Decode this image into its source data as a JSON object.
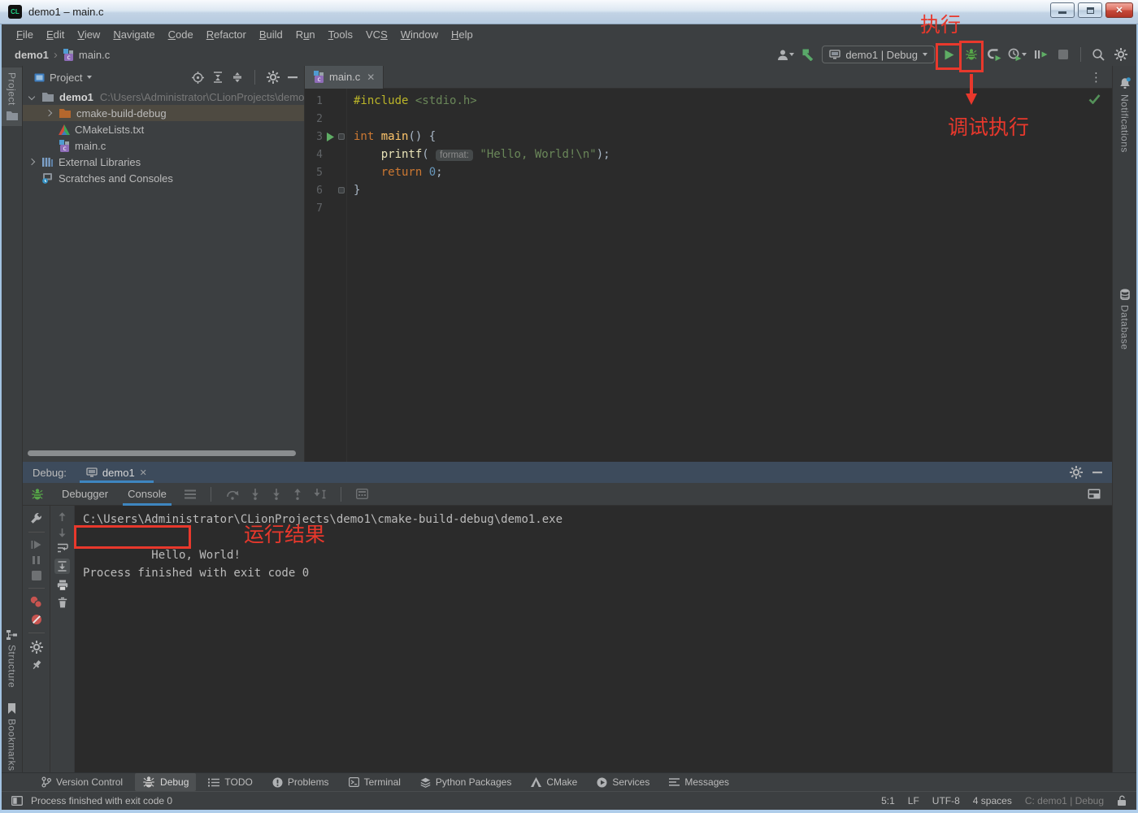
{
  "window": {
    "title": "demo1 – main.c",
    "logo_text": "CL"
  },
  "menu": {
    "items": [
      {
        "label": "File",
        "u": 0
      },
      {
        "label": "Edit",
        "u": 0
      },
      {
        "label": "View",
        "u": 0
      },
      {
        "label": "Navigate",
        "u": 0
      },
      {
        "label": "Code",
        "u": 0
      },
      {
        "label": "Refactor",
        "u": 0
      },
      {
        "label": "Build",
        "u": 0
      },
      {
        "label": "Run",
        "u": 1
      },
      {
        "label": "Tools",
        "u": 0
      },
      {
        "label": "VCS",
        "u": 2
      },
      {
        "label": "Window",
        "u": 0
      },
      {
        "label": "Help",
        "u": 0
      }
    ]
  },
  "breadcrumb": {
    "project": "demo1",
    "separator": "›",
    "file": "main.c"
  },
  "toolbar": {
    "run_config": "demo1 | Debug"
  },
  "left_stripe": {
    "project": "Project",
    "structure": "Structure",
    "bookmarks": "Bookmarks"
  },
  "right_stripe": {
    "notifications": "Notifications",
    "database": "Database"
  },
  "project_panel": {
    "title": "Project",
    "tree": [
      {
        "label": "demo1",
        "path": "C:\\Users\\Administrator\\CLionProjects\\demo",
        "icon": "folder",
        "chevron": "expanded",
        "indent": 0,
        "bold": true
      },
      {
        "label": "cmake-build-debug",
        "icon": "folder-excluded",
        "chevron": "collapsed",
        "indent": 1,
        "selected": true
      },
      {
        "label": "CMakeLists.txt",
        "icon": "cmake-file",
        "indent": 1
      },
      {
        "label": "main.c",
        "icon": "c-file",
        "indent": 1
      },
      {
        "label": "External Libraries",
        "icon": "library",
        "chevron": "collapsed",
        "indent": 0
      },
      {
        "label": "Scratches and Consoles",
        "icon": "scratches",
        "indent": 0
      }
    ]
  },
  "editor": {
    "tab": "main.c",
    "code_lines": [
      {
        "num": "1",
        "tokens": [
          {
            "t": "#include",
            "c": "directive"
          },
          {
            "t": " ",
            "c": "plain"
          },
          {
            "t": "<stdio.h>",
            "c": "string"
          }
        ]
      },
      {
        "num": "2",
        "tokens": []
      },
      {
        "num": "3",
        "run": true,
        "fold": true,
        "tokens": [
          {
            "t": "int",
            "c": "keyword"
          },
          {
            "t": " ",
            "c": "plain"
          },
          {
            "t": "main",
            "c": "fn"
          },
          {
            "t": "() {",
            "c": "plain"
          }
        ]
      },
      {
        "num": "4",
        "tokens": [
          {
            "t": "    ",
            "c": "plain"
          },
          {
            "t": "printf",
            "c": "call"
          },
          {
            "t": "( ",
            "c": "plain"
          },
          {
            "t": "format:",
            "c": "inlay"
          },
          {
            "t": " ",
            "c": "plain"
          },
          {
            "t": "\"Hello, World!\\n\"",
            "c": "string"
          },
          {
            "t": ");",
            "c": "plain"
          }
        ]
      },
      {
        "num": "5",
        "tokens": [
          {
            "t": "    ",
            "c": "plain"
          },
          {
            "t": "return",
            "c": "keyword"
          },
          {
            "t": " ",
            "c": "plain"
          },
          {
            "t": "0",
            "c": "num"
          },
          {
            "t": ";",
            "c": "plain"
          }
        ]
      },
      {
        "num": "6",
        "fold": true,
        "tokens": [
          {
            "t": "}",
            "c": "plain"
          }
        ]
      },
      {
        "num": "7",
        "tokens": []
      }
    ]
  },
  "debug_panel": {
    "label": "Debug:",
    "session_tab": "demo1",
    "tabs": {
      "debugger": "Debugger",
      "console": "Console"
    },
    "console_lines": {
      "command": "C:\\Users\\Administrator\\CLionProjects\\demo1\\cmake-build-debug\\demo1.exe",
      "output": "Hello, World!",
      "exit": "Process finished with exit code 0"
    }
  },
  "bottom_bar": {
    "items": [
      {
        "label": "Version Control",
        "icon": "branch-icon"
      },
      {
        "label": "Debug",
        "icon": "bug-gray-icon",
        "selected": true
      },
      {
        "label": "TODO",
        "icon": "todo-icon"
      },
      {
        "label": "Problems",
        "icon": "problems-icon"
      },
      {
        "label": "Terminal",
        "icon": "terminal-icon"
      },
      {
        "label": "Python Packages",
        "icon": "packages-icon"
      },
      {
        "label": "CMake",
        "icon": "cmake-tri-icon"
      },
      {
        "label": "Services",
        "icon": "services-icon"
      },
      {
        "label": "Messages",
        "icon": "messages-icon"
      }
    ]
  },
  "status_bar": {
    "message": "Process finished with exit code 0",
    "caret": "5:1",
    "line_sep": "LF",
    "encoding": "UTF-8",
    "indent": "4 spaces",
    "run_config": "C: demo1 | Debug"
  },
  "annotations": {
    "run_label": "执行",
    "debug_label": "调试执行",
    "result_label": "运行结果",
    "color": "#E8382C"
  },
  "colors": {
    "accent_blue": "#3E86C0",
    "run_green": "#5FAD65",
    "editor_bg": "#2B2B2B",
    "panel_bg": "#3C3F41",
    "debug_header": "#3D4B5C"
  }
}
